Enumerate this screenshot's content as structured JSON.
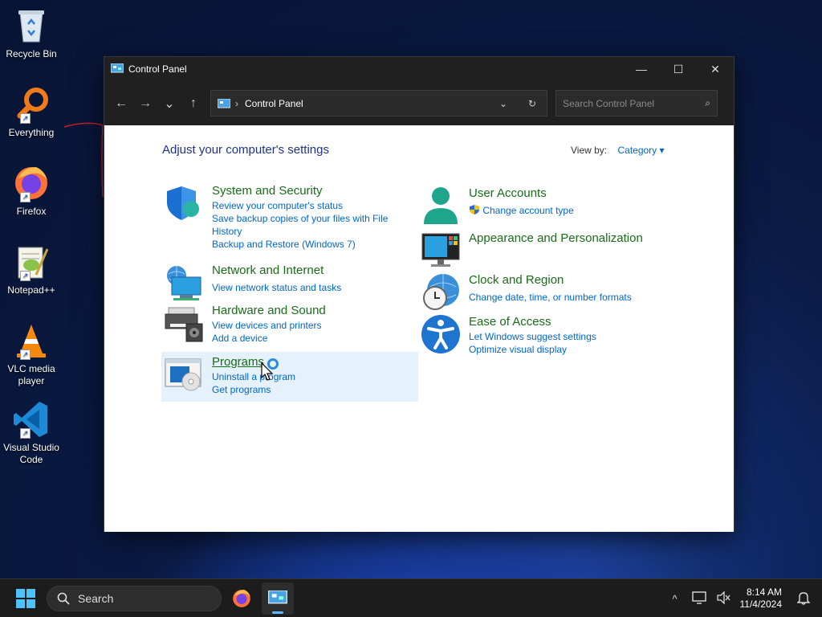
{
  "desktop": {
    "icons": [
      {
        "label": "Recycle Bin"
      },
      {
        "label": "Everything"
      },
      {
        "label": "Firefox"
      },
      {
        "label": "Notepad++"
      },
      {
        "label": "VLC media player"
      },
      {
        "label": "Visual Studio Code"
      }
    ]
  },
  "window": {
    "title": "Control Panel",
    "minimize": "—",
    "maximize": "☐",
    "close": "✕",
    "nav": {
      "back": "←",
      "forward": "→",
      "recent": "⌄",
      "up": "↑"
    },
    "address": {
      "separator": "›",
      "crumb": "Control Panel",
      "dropdown": "⌄",
      "refresh": "↻"
    },
    "search": {
      "placeholder": "Search Control Panel",
      "icon": "⌕"
    }
  },
  "content": {
    "heading": "Adjust your computer's settings",
    "view_by_label": "View by:",
    "view_by_value": "Category ▾",
    "categories": [
      {
        "title": "System and Security",
        "links": [
          "Review your computer's status",
          "Save backup copies of your files with File History",
          "Backup and Restore (Windows 7)"
        ]
      },
      {
        "title": "Network and Internet",
        "links": [
          "View network status and tasks"
        ]
      },
      {
        "title": "Hardware and Sound",
        "links": [
          "View devices and printers",
          "Add a device"
        ]
      },
      {
        "title": "Programs",
        "links": [
          "Uninstall a program",
          "Get programs"
        ]
      },
      {
        "title": "User Accounts",
        "links": [
          "Change account type"
        ]
      },
      {
        "title": "Appearance and Personalization",
        "links": []
      },
      {
        "title": "Clock and Region",
        "links": [
          "Change date, time, or number formats"
        ]
      },
      {
        "title": "Ease of Access",
        "links": [
          "Let Windows suggest settings",
          "Optimize visual display"
        ]
      }
    ]
  },
  "taskbar": {
    "search_label": "Search",
    "tray_chevron": "^",
    "clock_time": "8:14 AM",
    "clock_date": "11/4/2024"
  },
  "colors": {
    "accent": "#0066cc",
    "category_title": "#1a6b1a",
    "heading": "#1e3287",
    "highlight": "#e5f1fb"
  }
}
